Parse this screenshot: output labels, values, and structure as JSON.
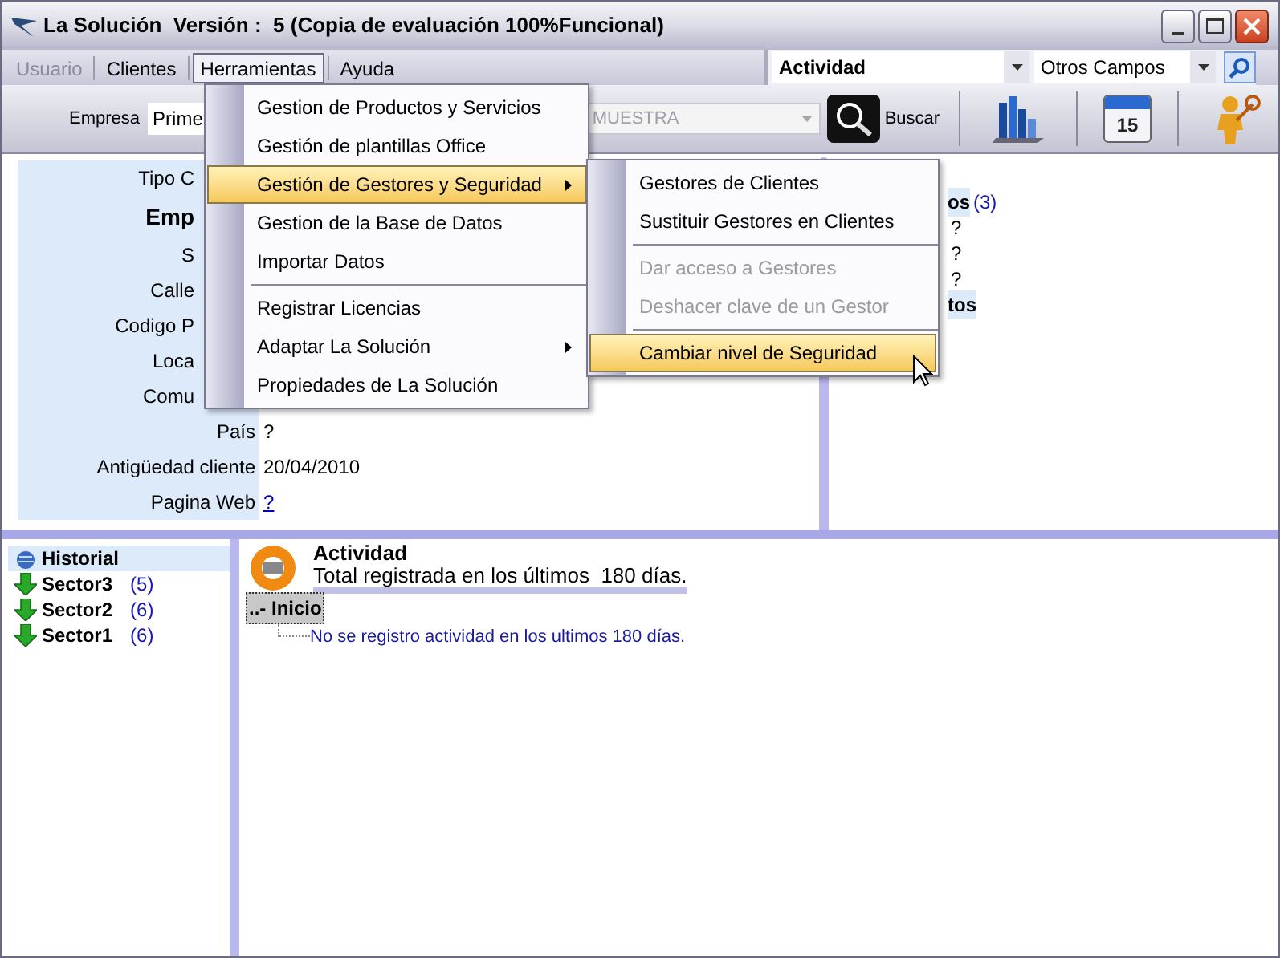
{
  "window": {
    "title": "La Solución  Versión :  5 (Copia de evaluación 100%Funcional)"
  },
  "menubar": [
    {
      "label": "Usuario",
      "disabled": true,
      "selected": false
    },
    {
      "label": "Clientes",
      "disabled": false,
      "selected": false
    },
    {
      "label": "Herramientas",
      "disabled": false,
      "selected": true
    },
    {
      "label": "Ayuda",
      "disabled": false,
      "selected": false
    }
  ],
  "filters": [
    {
      "value": "Actividad",
      "bold": true
    },
    {
      "value": "Otros Campos",
      "bold": false
    }
  ],
  "toolbar": {
    "empresa_label": "Empresa",
    "empresa_value": "Prime",
    "combo_value": "MUESTRA",
    "search_label": "Buscar",
    "calendar_day": "15"
  },
  "client_panel": [
    {
      "label": "Tipo C",
      "bold": false
    },
    {
      "label": "Emp",
      "bold": true
    },
    {
      "label": "S",
      "bold": false
    },
    {
      "label": "Calle",
      "bold": false
    },
    {
      "label": "Codigo P",
      "bold": false
    },
    {
      "label": "Loca",
      "bold": false
    },
    {
      "label": "Comu",
      "bold": false
    },
    {
      "label": "País",
      "bold": false,
      "value": "?",
      "link": false
    },
    {
      "label": "Antigüedad cliente",
      "bold": false,
      "value": "20/04/2010",
      "link": false
    },
    {
      "label": "Pagina Web",
      "bold": false,
      "value": "?",
      "link": true
    }
  ],
  "side_panel": [
    {
      "text": "os",
      "bold": true,
      "count": "(3)"
    },
    {
      "text": "?",
      "bold": false
    },
    {
      "text": "?",
      "bold": false
    },
    {
      "text": "?",
      "bold": false
    },
    {
      "text": "tos",
      "bold": true
    }
  ],
  "menu": [
    {
      "kind": "item",
      "label": "Gestion de Productos y Servicios",
      "selected": false,
      "submenu": false
    },
    {
      "kind": "item",
      "label": "Gestión de plantillas Office",
      "selected": false,
      "submenu": false
    },
    {
      "kind": "item",
      "label": "Gestión de Gestores y Seguridad",
      "selected": true,
      "submenu": true
    },
    {
      "kind": "item",
      "label": "Gestion de la Base de Datos",
      "selected": false,
      "submenu": false
    },
    {
      "kind": "item",
      "label": "Importar Datos",
      "selected": false,
      "submenu": false
    },
    {
      "kind": "separator"
    },
    {
      "kind": "item",
      "label": "Registrar Licencias",
      "selected": false,
      "submenu": false
    },
    {
      "kind": "item",
      "label": "Adaptar La Solución",
      "selected": false,
      "submenu": true
    },
    {
      "kind": "item",
      "label": "Propiedades de La Solución",
      "selected": false,
      "submenu": false
    }
  ],
  "submenu": [
    {
      "kind": "item",
      "label": "Gestores de Clientes",
      "selected": false,
      "disabled": false
    },
    {
      "kind": "item",
      "label": "Sustituir Gestores en Clientes",
      "selected": false,
      "disabled": false
    },
    {
      "kind": "separator"
    },
    {
      "kind": "item",
      "label": "Dar acceso a Gestores",
      "selected": false,
      "disabled": true
    },
    {
      "kind": "item",
      "label": "Deshacer clave de un Gestor",
      "selected": false,
      "disabled": true
    },
    {
      "kind": "separator"
    },
    {
      "kind": "item",
      "label": "Cambiar nivel de Seguridad",
      "selected": true,
      "disabled": false
    }
  ],
  "tree": [
    {
      "kind": "root",
      "label": "Historial",
      "selected": true
    },
    {
      "kind": "sector",
      "label": "Sector3",
      "count": "(5)",
      "selected": false
    },
    {
      "kind": "sector",
      "label": "Sector2",
      "count": "(6)",
      "selected": false
    },
    {
      "kind": "sector",
      "label": "Sector1",
      "count": "(6)",
      "selected": false
    }
  ],
  "activity": {
    "title": "Actividad",
    "subtitle": "Total registrada en los últimos  180 días.",
    "node": "..- Inicio",
    "message": "No se registro actividad en los ultimos 180 días."
  }
}
